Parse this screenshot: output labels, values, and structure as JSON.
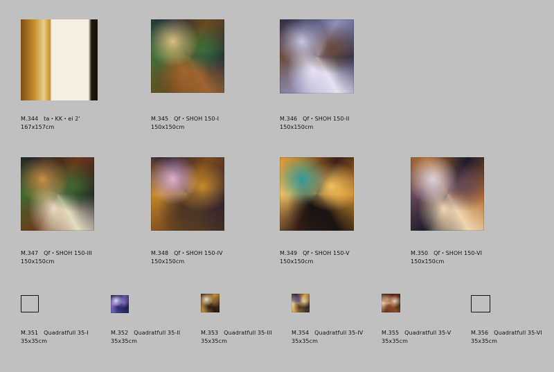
{
  "gallery": {
    "items": [
      {
        "id": "M.344",
        "title": "ta・KK・ei 2'",
        "size": "167x157cm",
        "image": "artwork-thumbnail",
        "palette": [
          "#c9902b",
          "#7a4f12",
          "#f4efe2",
          "#1d140c",
          "#e8d08a"
        ]
      },
      {
        "id": "M.345",
        "title": "Qf・SHOH 150-I",
        "size": "150x150cm",
        "image": "artwork-thumbnail",
        "palette": [
          "#6b4a1d",
          "#1d2b3a",
          "#d9c27a",
          "#3d6f3b",
          "#a0642f"
        ]
      },
      {
        "id": "M.346",
        "title": "Qf・SHOH 150-II",
        "size": "150x150cm",
        "image": "artwork-thumbnail",
        "palette": [
          "#8e8fb8",
          "#2a2a4a",
          "#c8c6e0",
          "#6a4a3a",
          "#e7e2f2"
        ]
      },
      {
        "id": "M.347",
        "title": "Qf・SHOH 150-III",
        "size": "150x150cm",
        "image": "artwork-thumbnail",
        "palette": [
          "#6a3a1a",
          "#1a1a22",
          "#c98f45",
          "#3f6a2f",
          "#e7dcc3"
        ]
      },
      {
        "id": "M.348",
        "title": "Qf・SHOH 150-IV",
        "size": "150x150cm",
        "image": "artwork-thumbnail",
        "palette": [
          "#7a4b1d",
          "#2a1c2f",
          "#e3b0d0",
          "#c48a2c",
          "#4a3526"
        ]
      },
      {
        "id": "M.349",
        "title": "Qf・SHOH 150-V",
        "size": "150x150cm",
        "image": "artwork-thumbnail",
        "palette": [
          "#3b1f18",
          "#d08a2a",
          "#2f9a9a",
          "#f0c060",
          "#1a1412"
        ]
      },
      {
        "id": "M.350",
        "title": "Qf・SHOH 150-VI",
        "size": "150x150cm",
        "image": "artwork-thumbnail",
        "palette": [
          "#1e1a2a",
          "#b06a2a",
          "#d9d2de",
          "#6a4a5a",
          "#f0d6b0"
        ]
      },
      {
        "id": "M.351",
        "title": "Quadratfull  35-I",
        "size": "35x35cm",
        "image": "empty-frame",
        "palette": []
      },
      {
        "id": "M.352",
        "title": "Quadratfull  35-II",
        "size": "35x35cm",
        "image": "artwork-thumbnail",
        "palette": [
          "#5a5aa8",
          "#1a1a3a",
          "#dcdcff",
          "#8a6ac0",
          "#2a2a6a"
        ]
      },
      {
        "id": "M.353",
        "title": "Quadratfull  35-III",
        "size": "35x35cm",
        "image": "artwork-thumbnail",
        "palette": [
          "#c4903a",
          "#4a2a14",
          "#f2e2bf",
          "#8a6a3a",
          "#2a1a12"
        ]
      },
      {
        "id": "M.354",
        "title": "Quadratfull  35-IV",
        "size": "35x35cm",
        "image": "artwork-thumbnail",
        "palette": [
          "#d4a24a",
          "#2a1a22",
          "#6a5a8a",
          "#f0d090",
          "#4a3a2a"
        ]
      },
      {
        "id": "M.355",
        "title": "Quadratfull  35-V",
        "size": "35x35cm",
        "image": "artwork-thumbnail",
        "palette": [
          "#6a2a1a",
          "#2a1a14",
          "#d09a6a",
          "#f0d2b0",
          "#8a4a2a"
        ]
      },
      {
        "id": "M.356",
        "title": "Quadratfull  35-VI",
        "size": "35x35cm",
        "image": "empty-frame",
        "palette": []
      }
    ]
  }
}
